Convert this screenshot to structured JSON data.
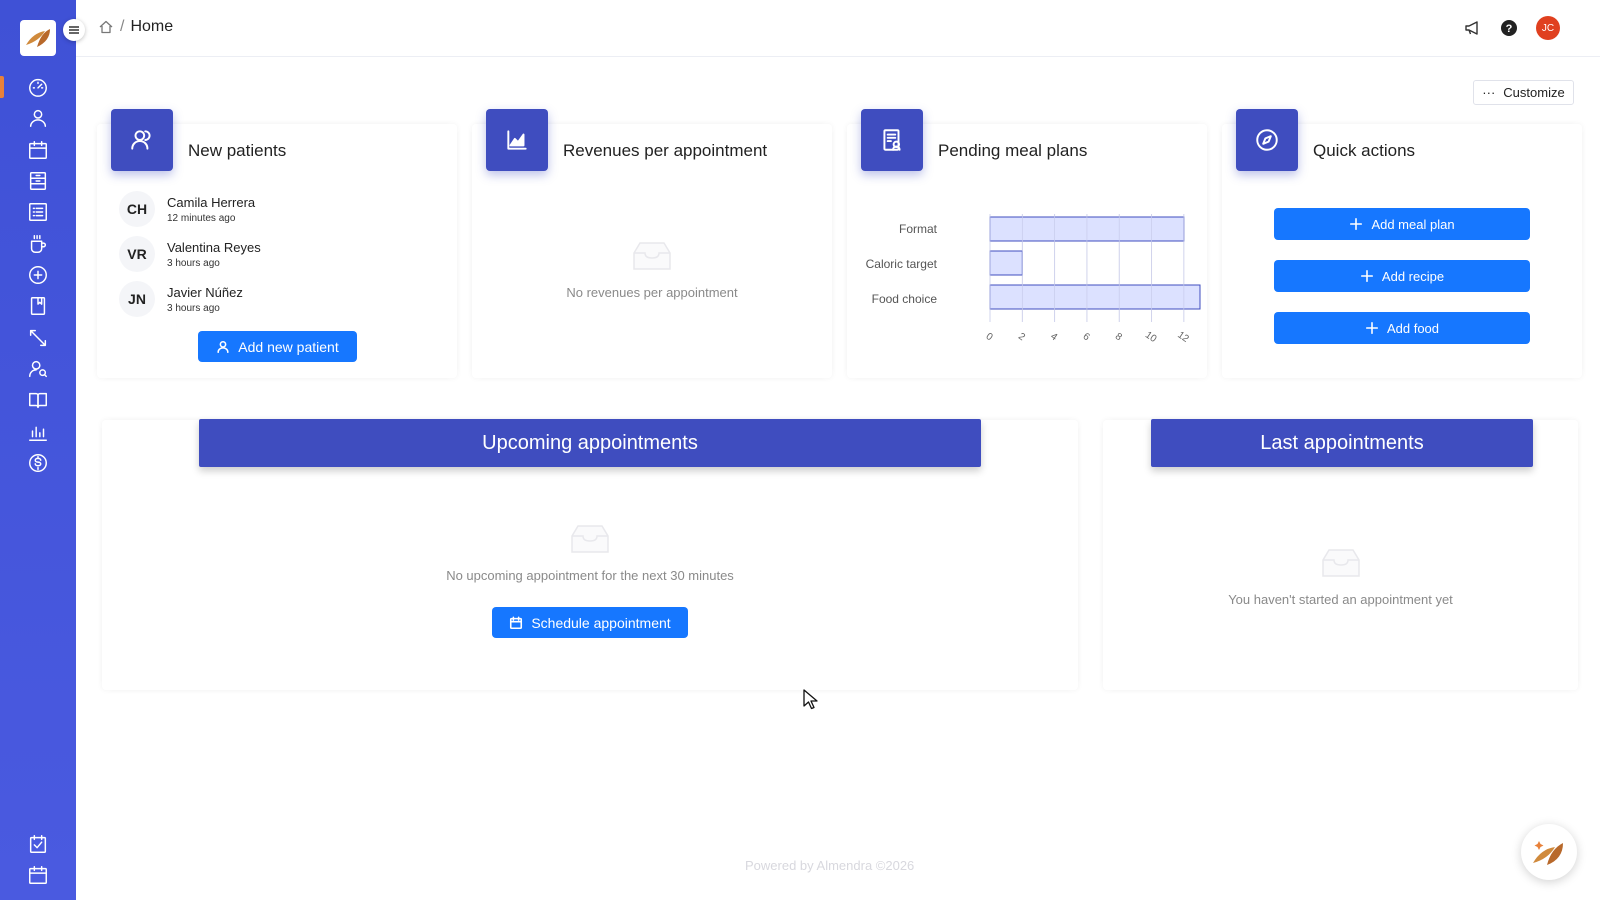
{
  "header": {
    "breadcrumb_current": "Home",
    "user_initials": "JC"
  },
  "customize_label": "Customize",
  "cards": {
    "new_patients": {
      "title": "New patients",
      "patients": [
        {
          "initials": "CH",
          "name": "Camila Herrera",
          "time": "12 minutes ago"
        },
        {
          "initials": "VR",
          "name": "Valentina Reyes",
          "time": "3 hours ago"
        },
        {
          "initials": "JN",
          "name": "Javier Núñez",
          "time": "3 hours ago"
        }
      ],
      "button_label": "Add new patient"
    },
    "revenues": {
      "title": "Revenues per appointment",
      "empty_text": "No revenues per appointment"
    },
    "meal_plans": {
      "title": "Pending meal plans"
    },
    "quick_actions": {
      "title": "Quick actions",
      "actions": [
        "Add meal plan",
        "Add recipe",
        "Add food"
      ]
    }
  },
  "chart_data": {
    "type": "bar",
    "orientation": "horizontal",
    "categories": [
      "Format",
      "Caloric target",
      "Food choice"
    ],
    "values": [
      12,
      2,
      13
    ],
    "xticks": [
      "0",
      "2",
      "4",
      "6",
      "8",
      "10",
      "12"
    ],
    "xlim": [
      0,
      13
    ],
    "grid": true,
    "bar_color": "#d6dcff",
    "bar_border": "#3f4dbf"
  },
  "panels": {
    "upcoming": {
      "title": "Upcoming appointments",
      "empty_text": "No upcoming appointment for the next 30 minutes",
      "button_label": "Schedule appointment"
    },
    "last": {
      "title": "Last appointments",
      "empty_text": "You haven't started an appointment yet"
    }
  },
  "footer": "Powered by Almendra ©2026",
  "colors": {
    "sidebar": "#3f51d6",
    "accent": "#3f4dbf",
    "primary_button": "#1677ff",
    "active_marker": "#e8813a"
  }
}
